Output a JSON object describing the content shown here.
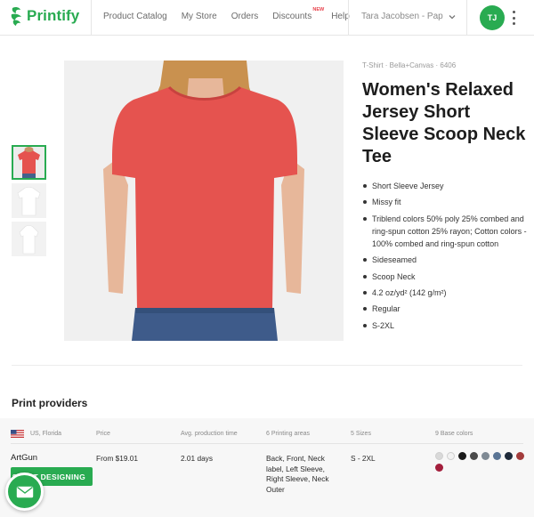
{
  "brand": {
    "name": "Printify",
    "color": "#29ab51"
  },
  "nav": {
    "items": [
      "Product Catalog",
      "My Store",
      "Orders",
      "Discounts",
      "Help"
    ],
    "discounts_badge": "NEW",
    "account": "Tara Jacobsen - Pap...",
    "avatar_initials": "TJ"
  },
  "product": {
    "breadcrumb": "T-Shirt · Bella+Canvas · 6406",
    "title": "Women's Relaxed Jersey Short Sleeve Scoop Neck Tee",
    "features": [
      "Short Sleeve Jersey",
      "Missy fit",
      "Triblend colors 50% poly 25% combed and ring-spun cotton 25% rayon; Cotton colors - 100% combed and ring-spun cotton",
      "Sideseamed",
      "Scoop Neck",
      "4.2 oz/yd² (142 g/m²)",
      "Regular",
      "S-2XL"
    ],
    "thumbnail_count": 3,
    "shirt_color": "#e5534f"
  },
  "print_providers": {
    "title": "Print providers",
    "headers": {
      "location": "US, Florida",
      "price": "Price",
      "production": "Avg. production time",
      "areas": "6 Printing areas",
      "sizes": "5 Sizes",
      "colors": "9 Base colors"
    },
    "provider": {
      "name": "ArtGun",
      "price": "From $19.01",
      "production": "2.01 days",
      "areas": "Back, Front, Neck label, Left Sleeve, Right Sleeve, Neck Outer",
      "sizes": "S - 2XL",
      "button": "START DESIGNING"
    },
    "base_colors": [
      "#d9d9d9",
      "#f2f2f2",
      "#1a1a1a",
      "#4a4a4a",
      "#7f8a94",
      "#5a7595",
      "#1e2a3a",
      "#a33c3c",
      "#a31f3c"
    ]
  }
}
